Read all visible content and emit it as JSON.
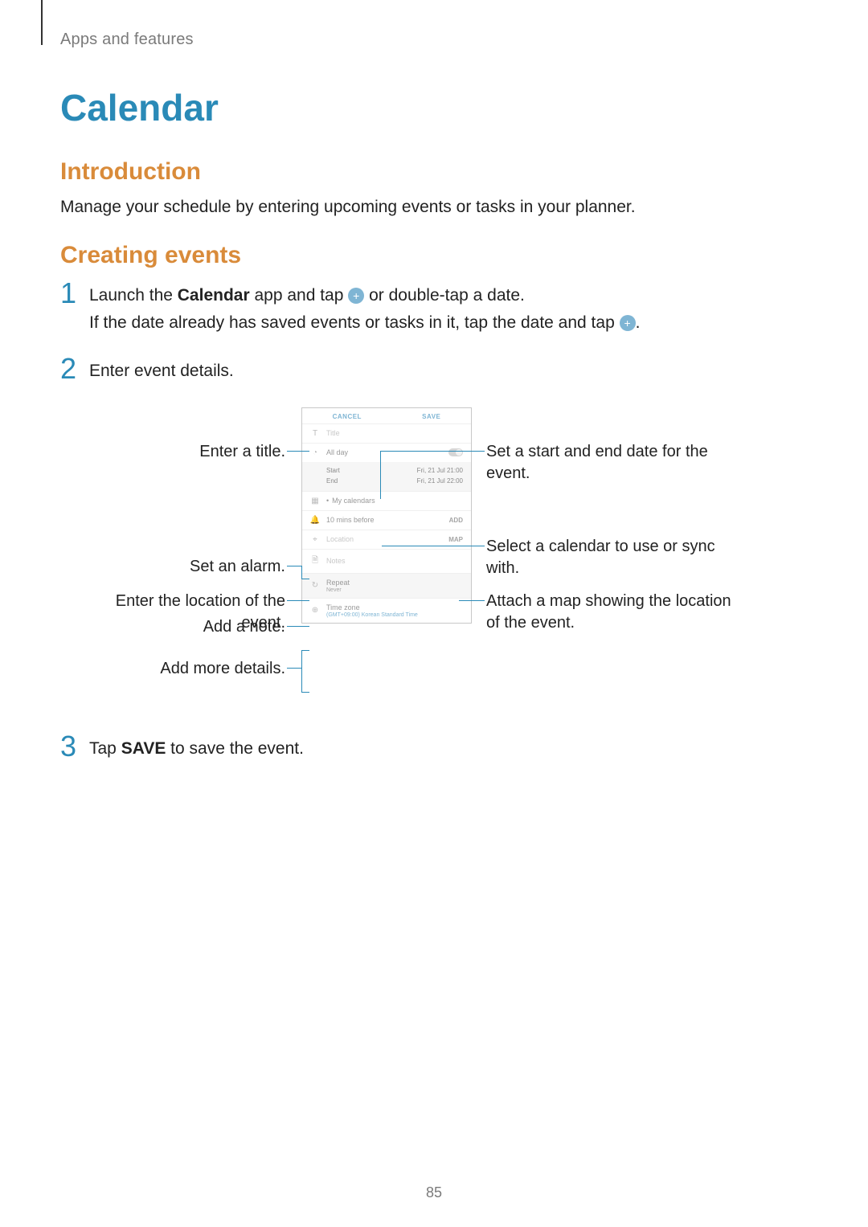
{
  "breadcrumb": "Apps and features",
  "title": "Calendar",
  "section_intro": "Introduction",
  "intro_body": "Manage your schedule by entering upcoming events or tasks in your planner.",
  "section_create": "Creating events",
  "steps": {
    "s1_a": "Launch the ",
    "s1_app": "Calendar",
    "s1_b": " app and tap ",
    "s1_c": " or double-tap a date.",
    "s1_line2_a": "If the date already has saved events or tasks in it, tap the date and tap ",
    "s1_line2_b": ".",
    "s2": "Enter event details.",
    "s3_a": "Tap ",
    "s3_save": "SAVE",
    "s3_b": " to save the event."
  },
  "phone": {
    "cancel": "CANCEL",
    "save": "SAVE",
    "title_placeholder": "Title",
    "allday": "All day",
    "start": "Start",
    "end": "End",
    "start_val": "Fri, 21 Jul   21:00",
    "end_val": "Fri, 21 Jul   22:00",
    "my_calendars": "My calendars",
    "alarm": "10 mins before",
    "alarm_action": "ADD",
    "location": "Location",
    "location_action": "MAP",
    "notes": "Notes",
    "repeat": "Repeat",
    "repeat_val": "Never",
    "timezone": "Time zone",
    "timezone_val": "(GMT+09:00) Korean Standard Time"
  },
  "callouts": {
    "enter_title": "Enter a title.",
    "set_alarm": "Set an alarm.",
    "enter_location": "Enter the location of the event.",
    "add_note": "Add a note.",
    "add_more": "Add more details.",
    "set_dates": "Set a start and end date for the event.",
    "select_calendar": "Select a calendar to use or sync with.",
    "attach_map": "Attach a map showing the location of the event."
  },
  "page_number": "85"
}
